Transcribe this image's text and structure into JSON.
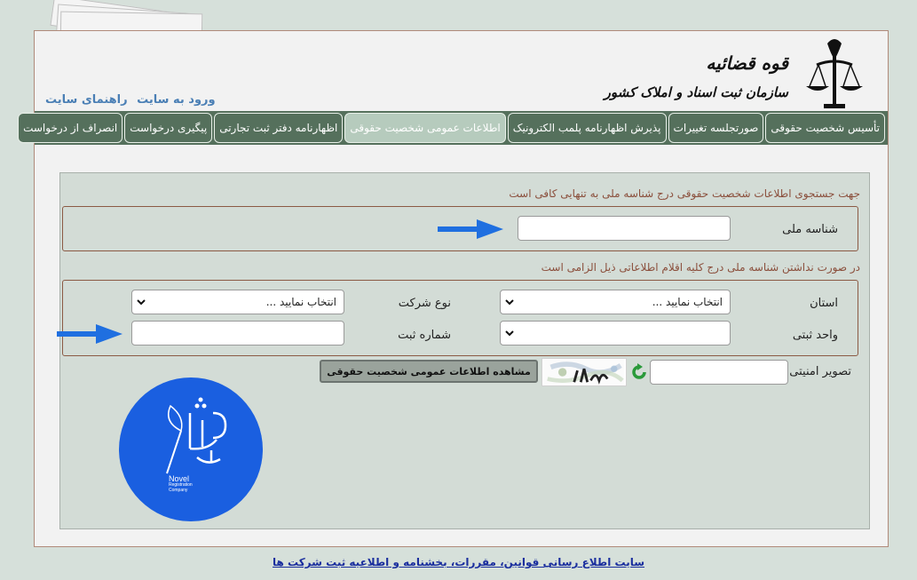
{
  "header": {
    "org_title": "قوه قضائیه",
    "org_subtitle": "سازمان ثبت اسناد و املاک کشور",
    "links": [
      "ورود به سایت",
      "راهنمای سایت"
    ]
  },
  "nav": {
    "tabs": [
      {
        "label": "تأسیس شخصیت حقوقی",
        "active": false
      },
      {
        "label": "صورتجلسه تغییرات",
        "active": false
      },
      {
        "label": "پذیرش اظهارنامه پلمب الکترونیک",
        "active": false
      },
      {
        "label": "اطلاعات عمومی شخصیت حقوقی",
        "active": true
      },
      {
        "label": "اظهارنامه دفتر ثبت تجارتی",
        "active": false
      },
      {
        "label": "پیگیری درخواست",
        "active": false
      },
      {
        "label": "انصراف از درخواست",
        "active": false
      }
    ]
  },
  "form": {
    "note1": "جهت جستجوی اطلاعات شخصیت حقوقی درج شناسه ملی به تنهایی کافی است",
    "national_id_label": "شناسه ملی",
    "national_id_value": "",
    "note2": "در صورت نداشتن شناسه ملی درج کلیه اقلام اطلاعاتی ذیل الزامی است",
    "province_label": "استان",
    "province_value": "انتخاب نمایید ...",
    "company_type_label": "نوع شرکت",
    "company_type_value": "انتخاب نمایید ...",
    "registry_unit_label": "واحد ثبتی",
    "registry_unit_value": "",
    "registration_number_label": "شماره ثبت",
    "registration_number_value": "",
    "security_image_label": "تصویر امنیتی",
    "security_code_value": "",
    "view_button": "مشاهده اطلاعات عمومی شخصیت حقوقی"
  },
  "badge": {
    "logo_text": "ثبت نوول",
    "name_line": "Novel",
    "sub_line1": "Registration",
    "sub_line2": "Company"
  },
  "footer": {
    "link": "سایت اطلاع رسانی قوانین، مقررات، بخشنامه و اطلاعیه ثبت شرکت ها"
  },
  "colors": {
    "nav_bg": "#55705c",
    "nav_active": "#b6cbbd",
    "panel_bg": "#d3dcd6",
    "note_text": "#8b4f3c",
    "arrow": "#1f6fe0",
    "badge_bg": "#1a5fe0",
    "link": "#4a7fb5"
  },
  "icons": {
    "emblem": "judiciary-emblem-icon",
    "arrow": "blue-arrow-icon",
    "refresh": "refresh-icon",
    "dropdown": "chevron-down-icon"
  }
}
